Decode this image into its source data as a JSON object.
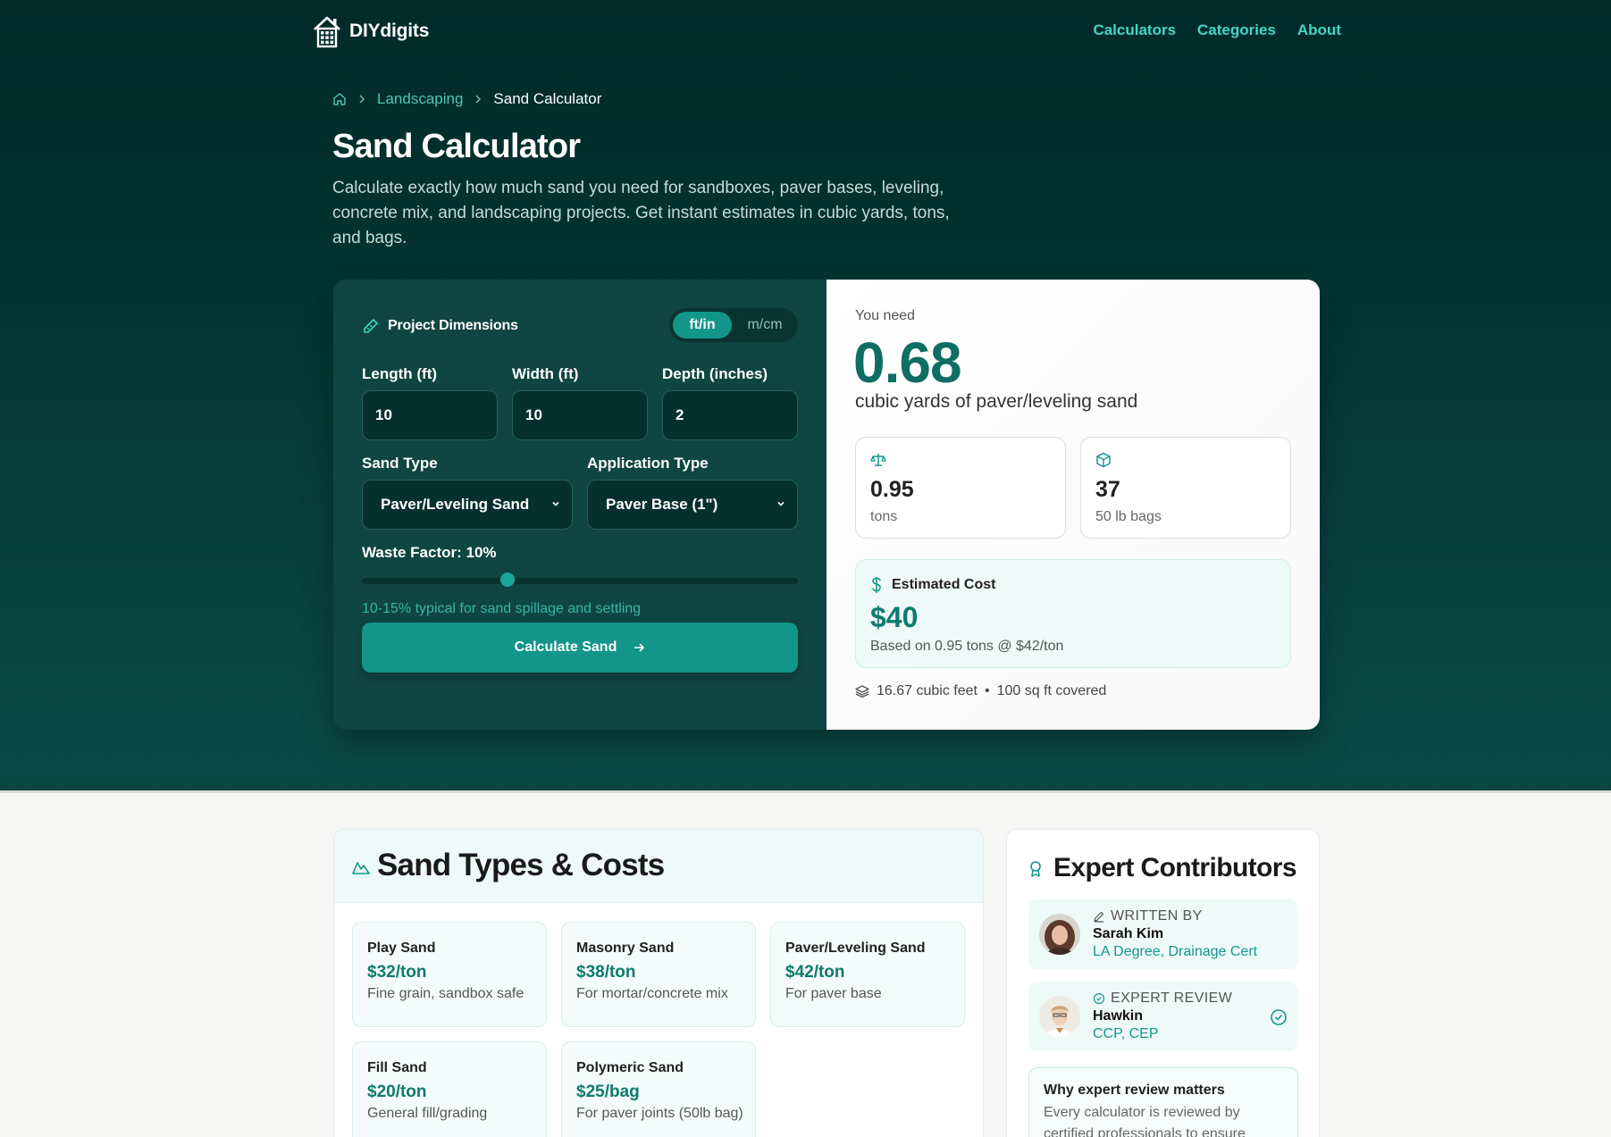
{
  "nav": {
    "brand": "DIYdigits",
    "links": [
      "Calculators",
      "Categories",
      "About"
    ]
  },
  "breadcrumb": {
    "parent": "Landscaping",
    "current": "Sand Calculator"
  },
  "page": {
    "title": "Sand Calculator",
    "description": "Calculate exactly how much sand you need for sandboxes, paver bases, leveling, concrete mix, and landscaping projects. Get instant estimates in cubic yards, tons, and bags."
  },
  "form": {
    "section_title": "Project Dimensions",
    "units": {
      "imperial": "ft/in",
      "metric": "m/cm",
      "selected": "ft/in"
    },
    "length": {
      "label": "Length (ft)",
      "value": "10"
    },
    "width": {
      "label": "Width (ft)",
      "value": "10"
    },
    "depth": {
      "label": "Depth (inches)",
      "value": "2"
    },
    "sand_type": {
      "label": "Sand Type",
      "value": "Paver/Leveling Sand"
    },
    "application_type": {
      "label": "Application Type",
      "value": "Paver Base (1\")"
    },
    "waste": {
      "label": "Waste Factor: 10%",
      "value_percent": 10,
      "min": 0,
      "max": 30,
      "hint": "10-15% typical for sand spillage and settling"
    },
    "submit_label": "Calculate Sand"
  },
  "result": {
    "lead": "You need",
    "volume": "0.68",
    "volume_unit": "cubic yards of paver/leveling sand",
    "tons": {
      "value": "0.95",
      "label": "tons"
    },
    "bags": {
      "value": "37",
      "label": "50 lb bags"
    },
    "cost": {
      "title": "Estimated Cost",
      "amount": "$40",
      "basis": "Based on 0.95 tons @ $42/ton"
    },
    "footer_cubic": "16.67 cubic feet",
    "footer_sep": "•",
    "footer_area": "100 sq ft covered"
  },
  "sand_types": {
    "title": "Sand Types & Costs",
    "items": [
      {
        "name": "Play Sand",
        "price": "$32/ton",
        "desc": "Fine grain, sandbox safe"
      },
      {
        "name": "Masonry Sand",
        "price": "$38/ton",
        "desc": "For mortar/concrete mix"
      },
      {
        "name": "Paver/Leveling Sand",
        "price": "$42/ton",
        "desc": "For paver base"
      },
      {
        "name": "Fill Sand",
        "price": "$20/ton",
        "desc": "General fill/grading"
      },
      {
        "name": "Polymeric Sand",
        "price": "$25/bag",
        "desc": "For paver joints (50lb bag)"
      }
    ]
  },
  "experts": {
    "title": "Expert Contributors",
    "writer": {
      "role": "WRITTEN BY",
      "name": "Sarah Kim",
      "cred1": "LA Degree",
      "cred_sep": ", ",
      "cred2": "Drainage Cert"
    },
    "reviewer": {
      "role": "EXPERT REVIEW",
      "name": "Hawkin",
      "cred1": "CCP",
      "cred_sep": ", ",
      "cred2": "CEP"
    },
    "why": {
      "title": "Why expert review matters",
      "body": "Every calculator is reviewed by certified professionals to ensure"
    }
  },
  "colors": {
    "hero_dark": "#012a29",
    "accent": "#13968a",
    "accent_text": "#0f7a6e",
    "link": "#45d6c2"
  }
}
